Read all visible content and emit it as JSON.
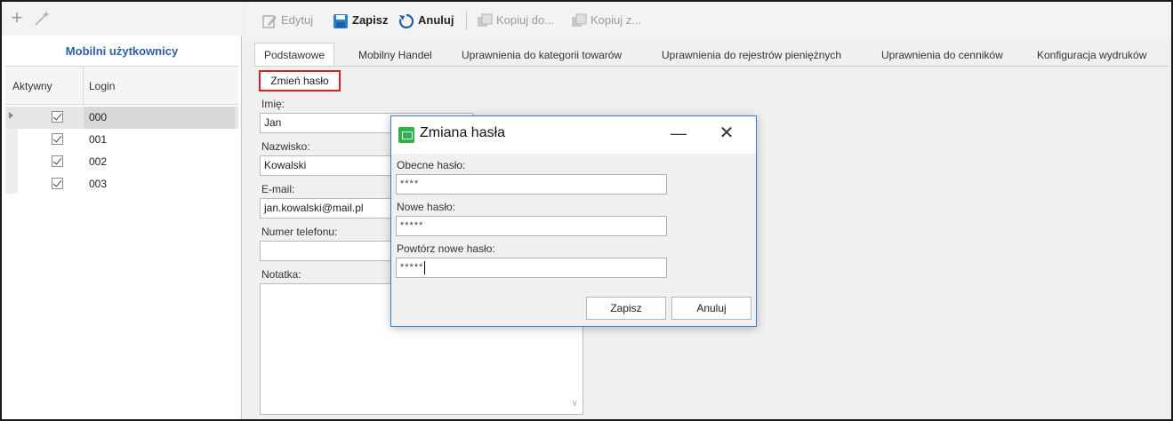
{
  "left_panel": {
    "title": "Mobilni użytkownicy",
    "icons": [
      "plus-icon",
      "magic-wand-icon"
    ],
    "columns": [
      "Aktywny",
      "Login"
    ],
    "rows": [
      {
        "active": true,
        "login": "000",
        "selected": true
      },
      {
        "active": true,
        "login": "001",
        "selected": false
      },
      {
        "active": true,
        "login": "002",
        "selected": false
      },
      {
        "active": true,
        "login": "003",
        "selected": false
      }
    ]
  },
  "toolbar": {
    "edit_label": "Edytuj",
    "save_label": "Zapisz",
    "cancel_label": "Anuluj",
    "copy_to_label": "Kopiuj do...",
    "copy_from_label": "Kopiuj z..."
  },
  "tabs": [
    "Podstawowe",
    "Mobilny Handel",
    "Uprawnienia do kategorii towarów",
    "Uprawnienia do rejestrów pieniężnych",
    "Uprawnienia do cenników",
    "Konfiguracja wydruków"
  ],
  "form": {
    "change_password_label": "Zmień hasło",
    "first_name_label": "Imię:",
    "first_name_value": "Jan",
    "last_name_label": "Nazwisko:",
    "last_name_value": "Kowalski",
    "email_label": "E-mail:",
    "email_value": "jan.kowalski@mail.pl",
    "phone_label": "Numer telefonu:",
    "phone_value": "",
    "notes_label": "Notatka:"
  },
  "dialog": {
    "title": "Zmiana hasła",
    "current_label": "Obecne hasło:",
    "current_value": "****",
    "new_label": "Nowe hasło:",
    "new_value": "*****",
    "repeat_label": "Powtórz nowe hasło:",
    "repeat_value": "*****",
    "save_label": "Zapisz",
    "cancel_label": "Anuluj"
  },
  "colors": {
    "accent_title": "#2d5fa8",
    "highlight_border": "#e01e1e",
    "dialog_border": "#3a7bd5",
    "dialog_icon": "#2db34a"
  }
}
